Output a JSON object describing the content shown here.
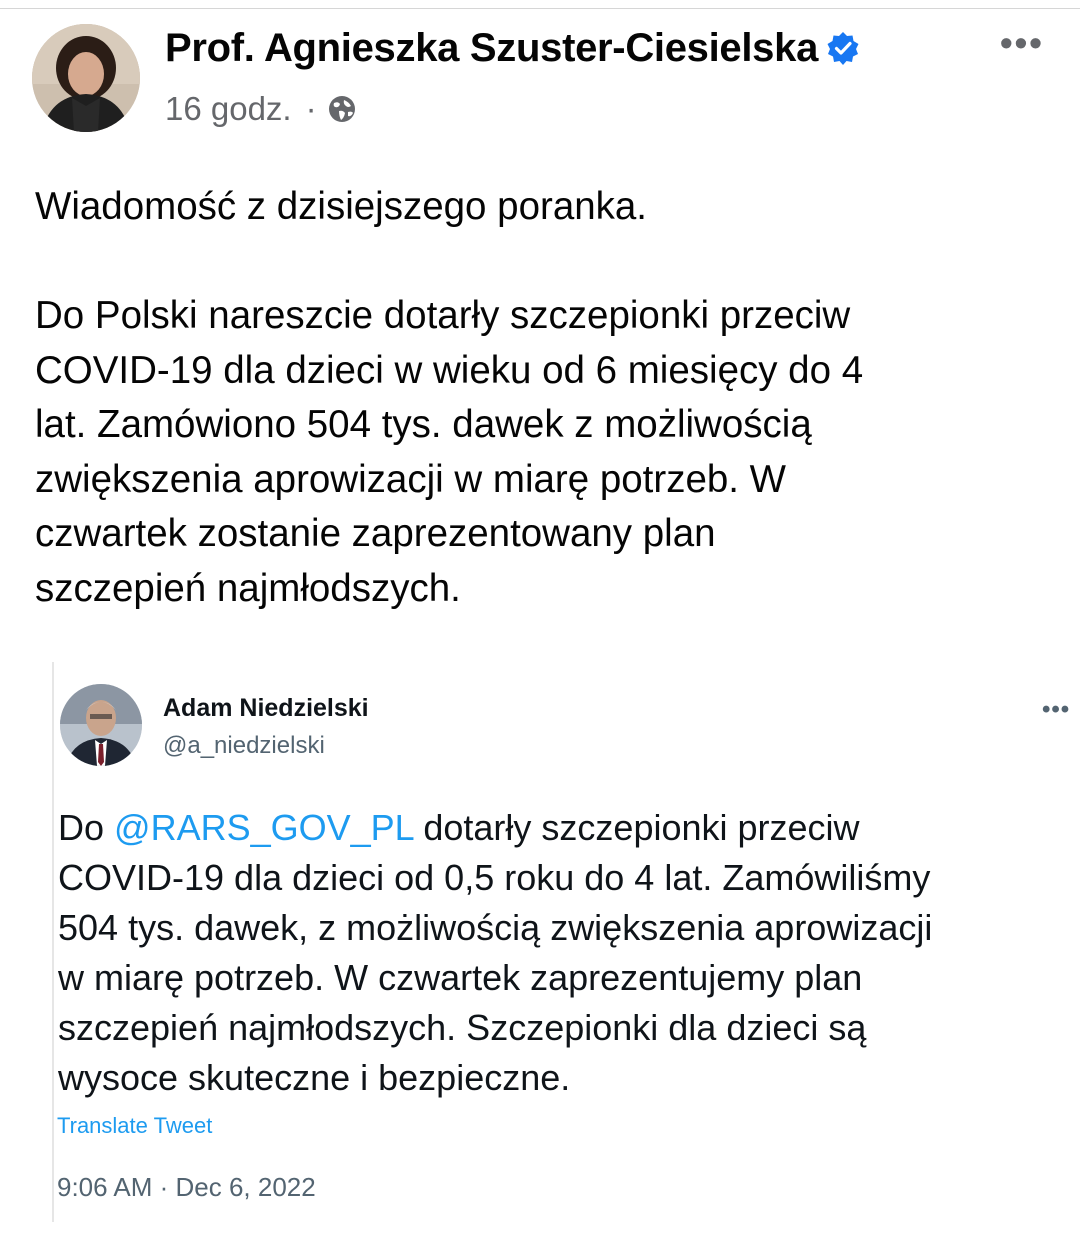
{
  "post": {
    "author": "Prof. Agnieszka Szuster-Ciesielska",
    "time": "16 godz.",
    "separator": "·",
    "more_label": "•••",
    "text_line1": "Wiadomość z dzisiejszego  poranka.",
    "text_lines": [
      "Do Polski nareszcie dotarły szczepionki przeciw",
      "COVID-19 dla dzieci w wieku od 6 miesięcy do 4",
      "lat. Zamówiono 504 tys. dawek z możliwością",
      "zwiększenia aprowizacji w miarę potrzeb. W",
      "czwartek zostanie zaprezentowany plan",
      "szczepień najmłodszych."
    ]
  },
  "tweet": {
    "name": "Adam Niedzielski",
    "handle": "@a_niedzielski",
    "more_label": "•••",
    "line1_prefix": "Do ",
    "mention": "@RARS_GOV_PL",
    "line1_suffix": " dotarły szczepionki przeciw",
    "lines": [
      "COVID-19 dla dzieci od 0,5 roku do 4 lat. Zamówiliśmy",
      "504 tys. dawek, z możliwością zwiększenia aprowizacji",
      "w miarę potrzeb. W czwartek zaprezentujemy plan",
      "szczepień najmłodszych. Szczepionki dla dzieci są",
      "wysoce skuteczne i bezpieczne."
    ],
    "translate_label": "Translate Tweet",
    "timestamp": "9:06 AM · Dec 6, 2022"
  },
  "colors": {
    "link_blue": "#1d9bf0",
    "verified_blue": "#1877f2",
    "meta_gray": "#65676b"
  },
  "icons": {
    "verified": "verified-badge-icon",
    "globe": "globe-icon",
    "more": "more-options-icon"
  }
}
